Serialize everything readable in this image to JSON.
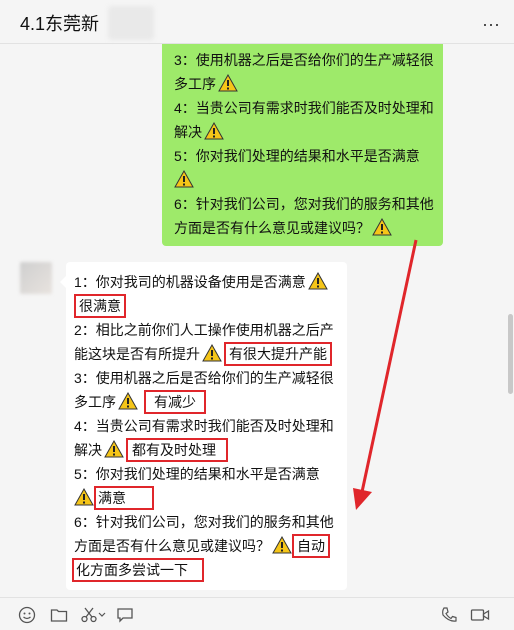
{
  "header": {
    "title": "4.1东莞新",
    "more_label": "···"
  },
  "messages": {
    "outgoing": [
      "3：使用机器之后是否给你们的生产减轻很",
      "多工序",
      "4：当贵公司有需求时我们能否及时处理和",
      "解决",
      "5：你对我们处理的结果和水平是否满意",
      "6：针对我们公司，您对我们的服务和其他",
      "方面是否有什么意见或建议吗？"
    ],
    "incoming": {
      "q1": "1：你对我司的机器设备使用是否满意",
      "a1": "很满意",
      "q2a": "2：相比之前你们人工操作使用机器之后产",
      "q2b": "能这块是否有所提升",
      "a2": "有很大提升产能",
      "q3a": "3：使用机器之后是否给你们的生产减轻很",
      "q3b": "多工序",
      "a3": "有减少",
      "q4a": "4：当贵公司有需求时我们能否及时处理和",
      "q4b": "解决",
      "a4": "都有及时处理",
      "q5": "5：你对我们处理的结果和水平是否满意",
      "a5": "满意",
      "q6a": "6：针对我们公司，您对我们的服务和其他",
      "q6b": "方面是否有什么意见或建议吗？",
      "a6a": "自动",
      "a6b": "化方面多尝试一下"
    }
  },
  "colors": {
    "outgoing_bubble": "#9eea6a",
    "highlight": "#e0262b",
    "warning": "#f5c518"
  },
  "toolbar": {
    "icons": [
      "emoji-icon",
      "folder-icon",
      "scissors-icon",
      "chat-history-icon",
      "phone-icon",
      "video-icon"
    ]
  }
}
